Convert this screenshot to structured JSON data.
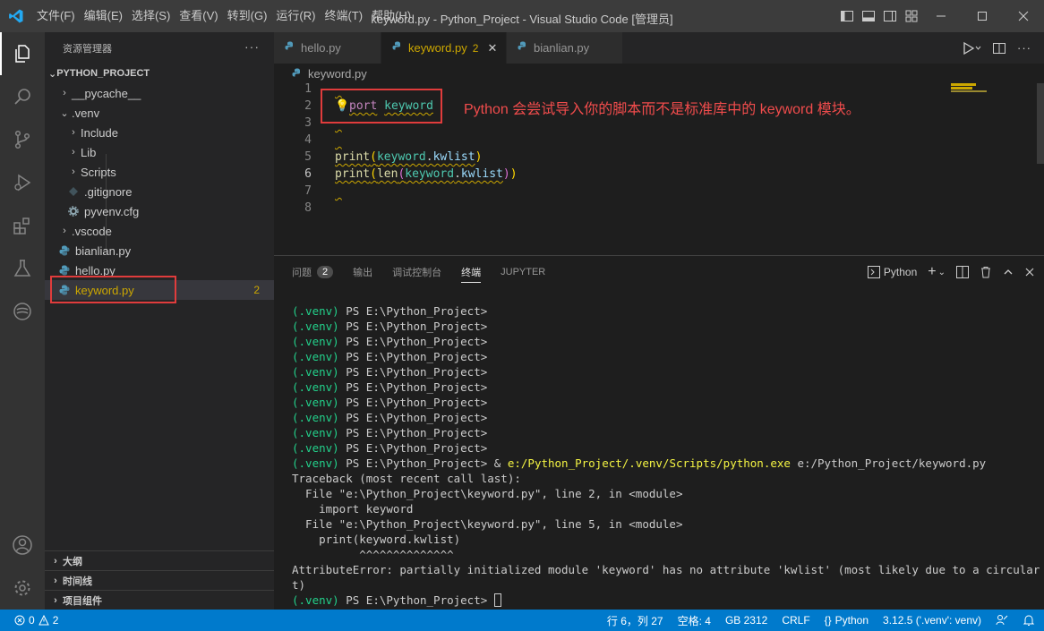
{
  "titlebar": {
    "menu": [
      "文件(F)",
      "编辑(E)",
      "选择(S)",
      "查看(V)",
      "转到(G)",
      "运行(R)",
      "终端(T)",
      "帮助(H)"
    ],
    "title": "keyword.py - Python_Project - Visual Studio Code [管理员]"
  },
  "sidebar": {
    "header": "资源管理器",
    "more": "···",
    "project": "PYTHON_PROJECT",
    "items": [
      {
        "label": "__pycache__"
      },
      {
        "label": ".venv"
      },
      {
        "label": "Include"
      },
      {
        "label": "Lib"
      },
      {
        "label": "Scripts"
      },
      {
        "label": ".gitignore"
      },
      {
        "label": "pyvenv.cfg"
      },
      {
        "label": ".vscode"
      },
      {
        "label": "bianlian.py"
      },
      {
        "label": "hello.py"
      },
      {
        "label": "keyword.py",
        "badge": "2"
      }
    ],
    "panes": [
      "大纲",
      "时间线",
      "项目组件"
    ]
  },
  "tabs": [
    {
      "label": "hello.py"
    },
    {
      "label": "keyword.py",
      "badge": "2"
    },
    {
      "label": "bianlian.py"
    }
  ],
  "breadcrumb": "keyword.py",
  "code": {
    "line_numbers": [
      "1",
      "2",
      "3",
      "4",
      "5",
      "6",
      "7",
      "8"
    ],
    "line2_a": "port",
    "line2_b": "keyword",
    "line5": {
      "fn": "print",
      "mod": "keyword",
      "attr": "kwlist"
    },
    "line6": {
      "fn": "print",
      "fn2": "len",
      "mod": "keyword",
      "attr": "kwlist"
    }
  },
  "annotation": "Python 会尝试导入你的脚本而不是标准库中的 keyword 模块。",
  "panel": {
    "tabs": [
      "问题",
      "输出",
      "调试控制台",
      "终端",
      "JUPYTER"
    ],
    "problems_count": "2",
    "shell_label": "Python"
  },
  "terminal": {
    "prompt_venv": "(.venv)",
    "prompt_path": " PS E:\\Python_Project> ",
    "cmd_exe": "e:/Python_Project/.venv/Scripts/python.exe",
    "cmd_arg": " e:/Python_Project/keyword.py",
    "traceback": [
      "Traceback (most recent call last):",
      "  File \"e:\\Python_Project\\keyword.py\", line 2, in <module>",
      "    import keyword",
      "  File \"e:\\Python_Project\\keyword.py\", line 5, in <module>",
      "    print(keyword.kwlist)",
      "          ^^^^^^^^^^^^^^",
      "AttributeError: partially initialized module 'keyword' has no attribute 'kwlist' (most likely due to a circular impor",
      "t)"
    ]
  },
  "statusbar": {
    "errors": "0",
    "warnings": "2",
    "position": "行 6，列 27",
    "spaces": "空格: 4",
    "encoding": "GB 2312",
    "eol": "CRLF",
    "language": "Python",
    "interpreter": "3.12.5 ('.venv': venv)"
  },
  "colors": {
    "accent": "#007acc",
    "warning": "#cca700",
    "annotation_red": "#e03c3c"
  }
}
